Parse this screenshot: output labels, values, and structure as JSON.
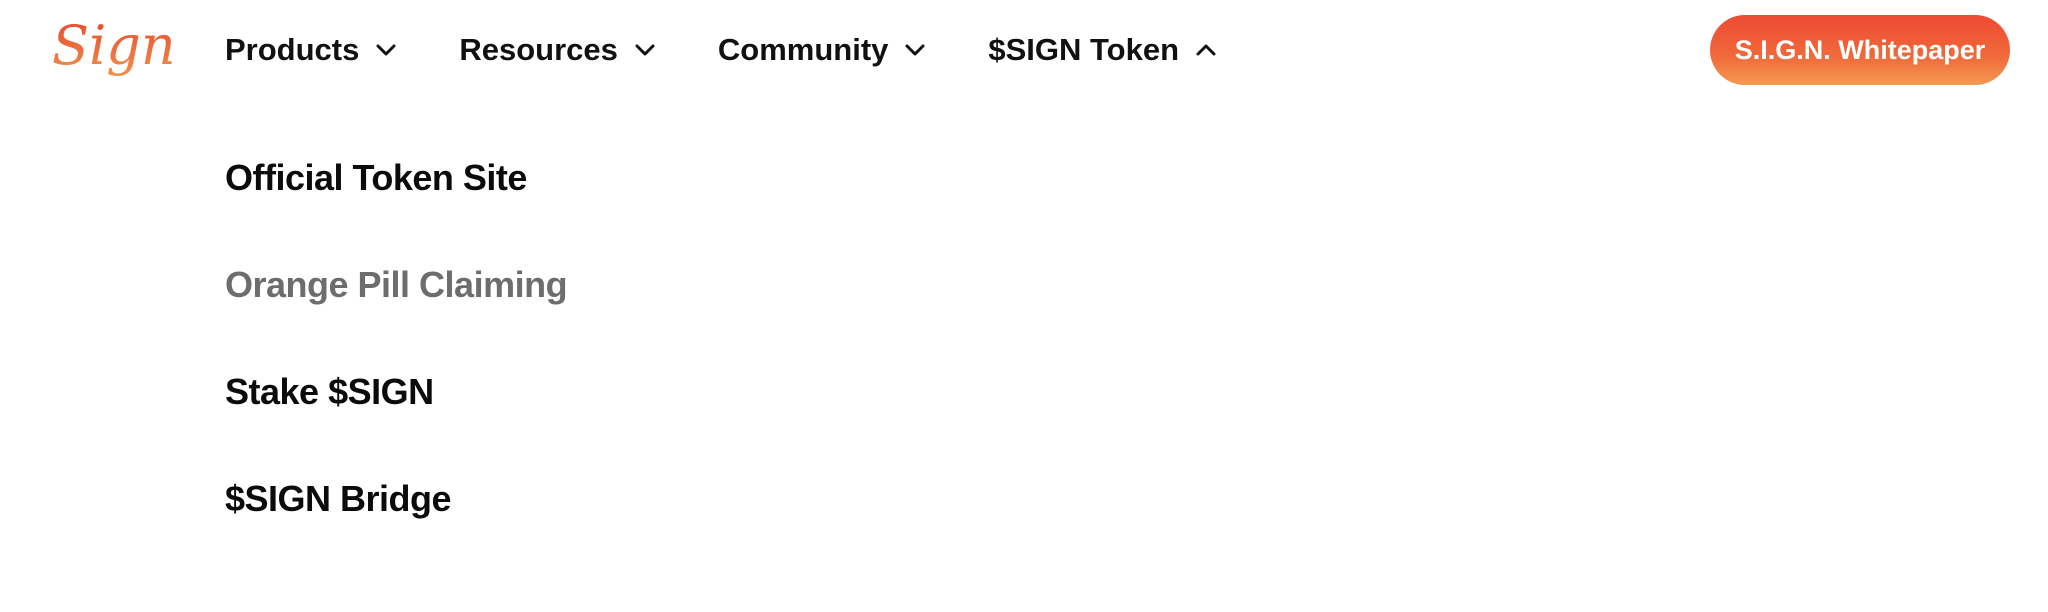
{
  "brand": {
    "logo_text": "Sign",
    "accent_color": "#ee5a37"
  },
  "nav": {
    "items": [
      {
        "label": "Products",
        "icon": "chevron-down-icon"
      },
      {
        "label": "Resources",
        "icon": "chevron-down-icon"
      },
      {
        "label": "Community",
        "icon": "chevron-down-icon"
      },
      {
        "label": "$SIGN Token",
        "icon": "chevron-up-icon"
      }
    ]
  },
  "cta": {
    "label": "S.I.G.N. Whitepaper"
  },
  "dropdown": {
    "items": [
      {
        "label": "Official Token Site"
      },
      {
        "label": "Orange Pill Claiming",
        "color": "#6d6d6d"
      },
      {
        "label": "Stake $SIGN"
      },
      {
        "label": "$SIGN Bridge"
      }
    ]
  }
}
